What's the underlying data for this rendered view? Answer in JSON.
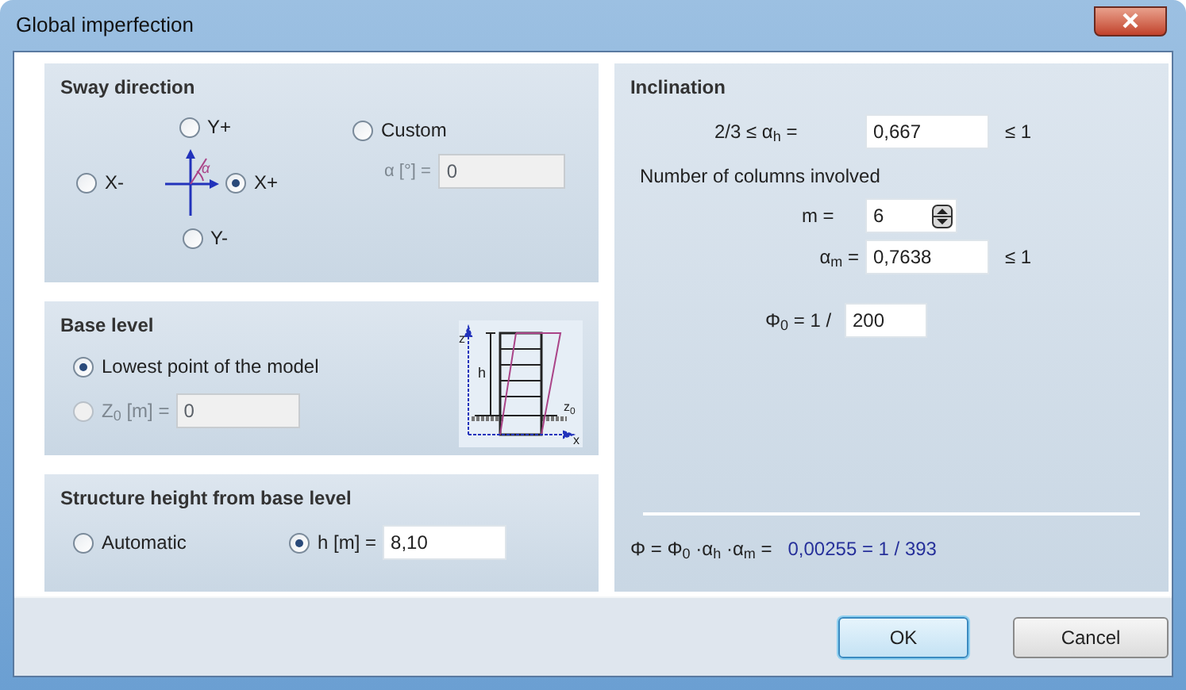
{
  "window": {
    "title": "Global imperfection"
  },
  "sway_direction": {
    "title": "Sway direction",
    "options": [
      {
        "label": "Y+",
        "selected": false
      },
      {
        "label": "X-",
        "selected": false
      },
      {
        "label": "X+",
        "selected": true
      },
      {
        "label": "Y-",
        "selected": false
      },
      {
        "label": "Custom",
        "selected": false
      }
    ],
    "angle": {
      "label": "α [°] =",
      "value": "0",
      "disabled": true
    },
    "axes_drawing": {
      "angle_symbol": "α"
    }
  },
  "base_level": {
    "title": "Base level",
    "options": [
      {
        "label": "Lowest point of the model",
        "selected": true,
        "disabled": false
      },
      {
        "label": "Z$_{0}$ [m] =",
        "selected": false,
        "disabled": true
      }
    ],
    "z0": {
      "value": "0",
      "disabled": true
    },
    "drawing": {
      "axis_z": "z",
      "height": "h",
      "base": "z",
      "base_index": "0",
      "axis_x": "x"
    }
  },
  "structure_height": {
    "title": "Structure height from base level",
    "options": [
      {
        "label": "Automatic",
        "selected": false
      },
      {
        "label": "h [m] =",
        "selected": true
      }
    ],
    "h": {
      "value": "8,10"
    }
  },
  "inclination": {
    "title": "Inclination",
    "alpha_h": {
      "label": "2/3 ≤  α$_{h}$  =",
      "value": "0,667",
      "limit": "≤ 1"
    },
    "columns_label": "Number of columns involved",
    "m": {
      "label": "m =",
      "value": "6"
    },
    "alpha_m": {
      "label": "α$_{m}$  =",
      "value": "0,7638",
      "limit": "≤ 1"
    },
    "phi0": {
      "label": "Φ$_{0}$  = 1 /",
      "value": "200"
    },
    "result": {
      "label": "Φ = Φ$_{0}$ ·α$_{h}$ ·α$_{m}$  =",
      "value": "0,00255 = 1 / 393"
    }
  },
  "buttons": [
    {
      "label": "OK",
      "default": true
    },
    {
      "label": "Cancel",
      "default": false
    }
  ]
}
